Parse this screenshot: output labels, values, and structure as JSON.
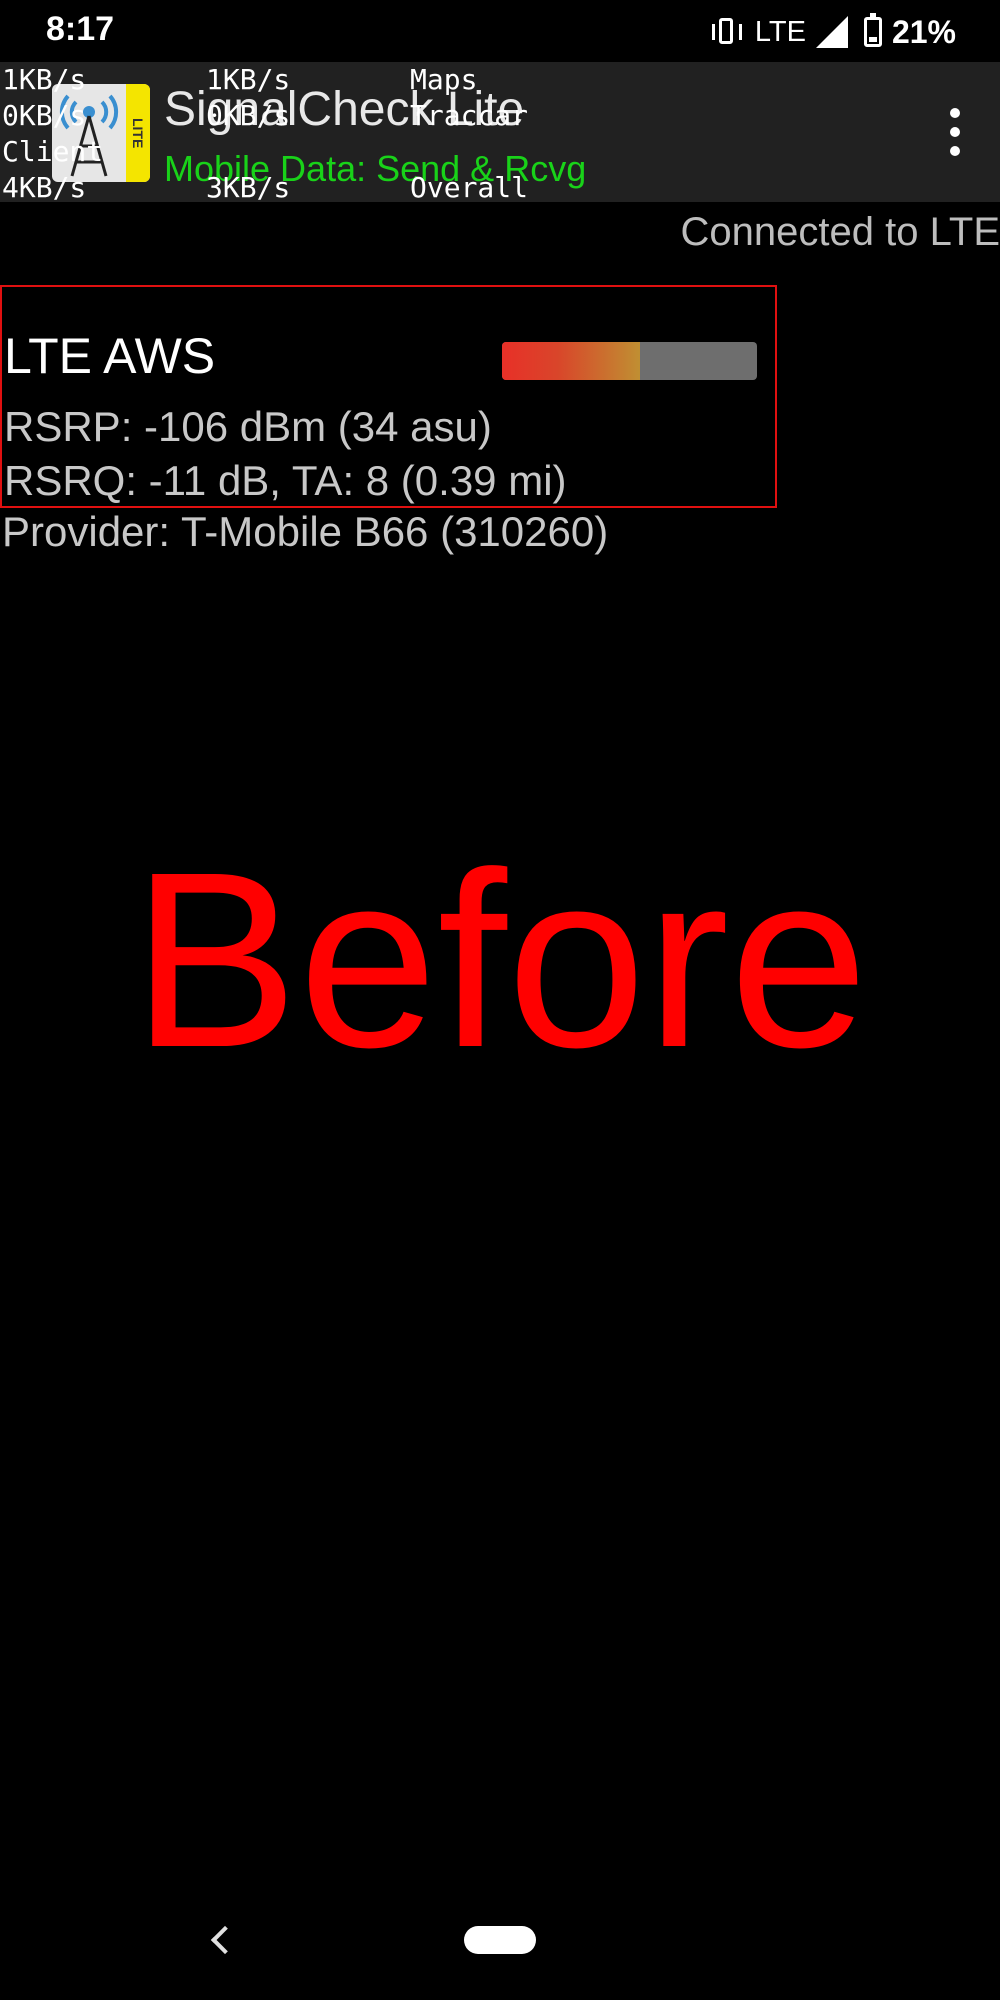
{
  "status_bar": {
    "time": "8:17",
    "network": "LTE",
    "battery": "21%",
    "icons": [
      "vibrate-icon",
      "signal-icon",
      "battery-icon"
    ]
  },
  "app_bar": {
    "title": "SignalCheck Lite",
    "subtitle": "Mobile Data: Send & Rcvg",
    "icon_badge": "LITE",
    "menu_icon": "more-vert-icon"
  },
  "traffic": {
    "rows": [
      [
        "1KB/s",
        "1KB/s",
        "Maps"
      ],
      [
        "0KB/s",
        "0KB/s",
        "Traccar"
      ],
      [
        "Client",
        "",
        ""
      ],
      [
        "4KB/s",
        "3KB/s",
        "Overall"
      ]
    ]
  },
  "connection": {
    "status": "Connected to LTE"
  },
  "signal": {
    "band": "LTE AWS",
    "strength_fraction": 0.54,
    "rsrp": "RSRP: -106 dBm (34 asu)",
    "rsrq": "RSRQ: -11 dB, TA: 8 (0.39 mi)",
    "provider": "Provider: T-Mobile B66 (310260)"
  },
  "overlay": {
    "label": "Before"
  },
  "colors": {
    "subtitle_green": "#19d219",
    "box_red": "#e01010",
    "overlay_red": "#ff0000"
  }
}
